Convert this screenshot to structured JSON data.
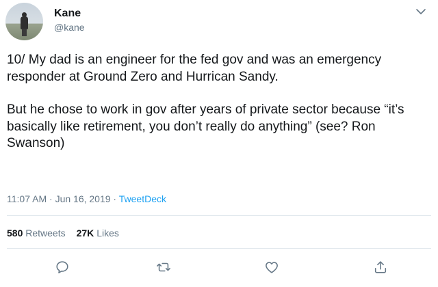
{
  "author": {
    "name": "Kane",
    "handle": "@kane",
    "avatar_icon": "profile-photo"
  },
  "tweet": {
    "paragraphs": [
      "10/ My dad is an engineer for the fed gov and was an emergency responder at Ground Zero and Hurrican Sandy.",
      "But he chose to work in gov after years of private sector because “it’s basically like retirement, you don’t really do anything” (see? Ron Swanson)"
    ],
    "time": "11:07 AM",
    "separator": " · ",
    "date": "Jun 16, 2019",
    "source": "TweetDeck"
  },
  "stats": {
    "retweets_count": "580",
    "retweets_label": "Retweets",
    "likes_count": "27K",
    "likes_label": "Likes"
  },
  "actions": {
    "reply_icon": "reply-icon",
    "retweet_icon": "retweet-icon",
    "like_icon": "heart-icon",
    "share_icon": "share-icon"
  },
  "colors": {
    "text": "#14171a",
    "secondary": "#657786",
    "link": "#1da1f2",
    "divider": "#e1e8ed"
  }
}
